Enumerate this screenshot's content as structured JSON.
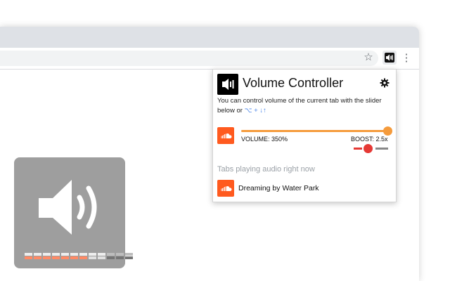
{
  "browser": {
    "star_icon": "star-icon",
    "extension_icon": "volume-controller-icon",
    "menu_icon": "vertical-dots-icon"
  },
  "popup": {
    "title": "Volume Controller",
    "description": "You can control volume of the current tab with the slider below or",
    "shortcut_keys": "⌥ + ↓↑",
    "volume": {
      "label": "VOLUME: 350%",
      "level_fraction": 1.0
    },
    "boost": {
      "label": "BOOST: 2.5x",
      "level_fraction": 0.4
    },
    "section_heading": "Tabs playing audio right now",
    "tabs": [
      {
        "title": "Dreaming by Water Park",
        "icon": "soundcloud-icon"
      }
    ],
    "colors": {
      "volume_accent": "#f59b3c",
      "boost_accent": "#e53935",
      "soundcloud": "#ff5a1f"
    }
  },
  "osd": {
    "icon": "speaker-icon",
    "segments_total": 12,
    "segments_active": 7,
    "colors": {
      "background": "#9e9e9e",
      "active": "#ff8a65",
      "inactive": "#e0e0e0",
      "overboost": "#757575"
    }
  }
}
